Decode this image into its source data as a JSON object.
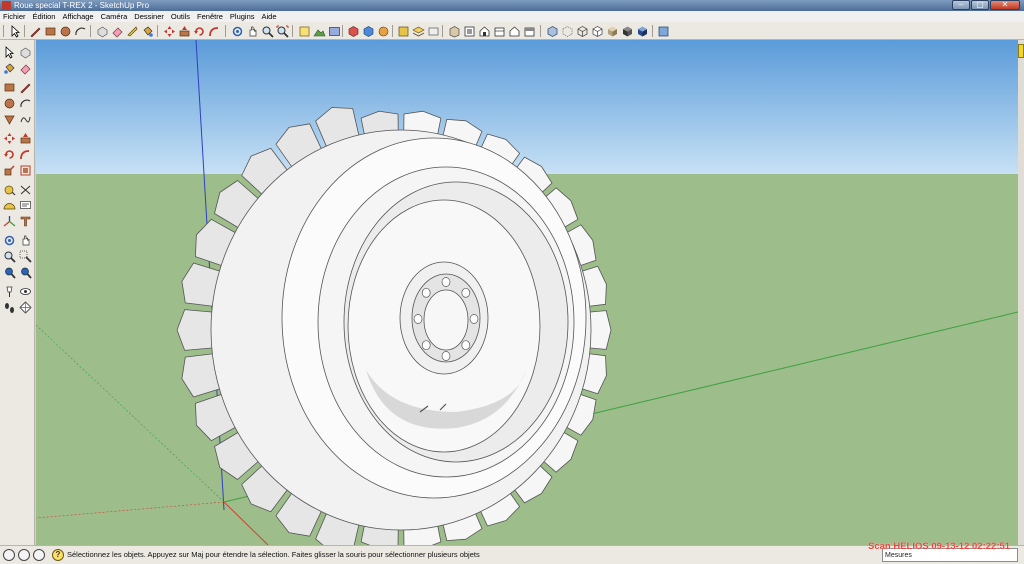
{
  "window": {
    "title": "Roue special T-REX 2 - SketchUp Pro",
    "controls": {
      "minimize": "–",
      "maximize": "▢",
      "close": "✕"
    }
  },
  "menubar": {
    "items": [
      "Fichier",
      "Édition",
      "Affichage",
      "Caméra",
      "Dessiner",
      "Outils",
      "Fenêtre",
      "Plugins",
      "Aide"
    ]
  },
  "toolbar": {
    "icons": [
      "select-icon",
      "pencil-icon",
      "rectangle-icon",
      "circle-icon",
      "arc-icon",
      "eraser-icon",
      "paint-bucket-icon",
      "push-pull-icon",
      "move-icon",
      "rotate-icon",
      "offset-icon",
      "orbit-icon",
      "pan-icon",
      "zoom-icon",
      "zoom-extents-icon",
      "iso-view-icon",
      "top-view-icon",
      "front-view-icon",
      "right-view-icon",
      "back-view-icon",
      "left-view-icon",
      "xray-icon",
      "wireframe-icon",
      "hidden-line-icon",
      "shaded-icon",
      "textured-icon"
    ]
  },
  "left_toolbar": {
    "icons": [
      "select-icon",
      "component-icon",
      "paint-icon",
      "eraser-icon",
      "rectangle-icon",
      "line-icon",
      "circle-icon",
      "arc-icon",
      "polygon-icon",
      "freehand-icon",
      "move-icon",
      "push-pull-icon",
      "rotate-icon",
      "follow-me-icon",
      "scale-icon",
      "offset-icon",
      "tape-measure-icon",
      "dimension-icon",
      "protractor-icon",
      "text-icon",
      "axes-icon",
      "3d-text-icon",
      "orbit-icon",
      "pan-icon",
      "zoom-icon",
      "zoom-window-icon",
      "previous-view-icon",
      "zoom-extents-icon",
      "position-camera-icon",
      "look-around-icon",
      "walk-icon",
      "section-plane-icon"
    ]
  },
  "colors": {
    "sky_top": "#5b9bd9",
    "sky_bottom": "#c7e1f5",
    "ground": "#9dbd8a",
    "axis_red": "#d04030",
    "axis_green": "#3aa040",
    "axis_blue": "#3040c0",
    "tire": "#f4f4f4",
    "tire_edge": "#555555",
    "watermark": "#e8463e"
  },
  "statusbar": {
    "text": "Sélectionnez les objets. Appuyez sur Maj pour étendre la sélection. Faites glisser la souris pour sélectionner plusieurs objets",
    "mesures_label": "Mesures",
    "mesures_value": ""
  },
  "watermark": "Scan HELIOS 09-13-12 02:22:51"
}
